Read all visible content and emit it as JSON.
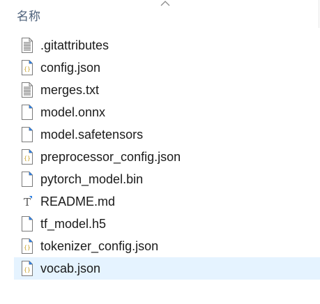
{
  "header": {
    "column_name": "名称",
    "sort_icon": "chevron-up-icon"
  },
  "files": [
    {
      "name": ".gitattributes",
      "icon": "text-file-icon"
    },
    {
      "name": "config.json",
      "icon": "json-file-icon"
    },
    {
      "name": "merges.txt",
      "icon": "text-file-icon"
    },
    {
      "name": "model.onnx",
      "icon": "blank-file-icon"
    },
    {
      "name": "model.safetensors",
      "icon": "blank-file-icon"
    },
    {
      "name": "preprocessor_config.json",
      "icon": "json-file-icon"
    },
    {
      "name": "pytorch_model.bin",
      "icon": "blank-file-icon"
    },
    {
      "name": "README.md",
      "icon": "typora-file-icon"
    },
    {
      "name": "tf_model.h5",
      "icon": "blank-file-icon"
    },
    {
      "name": "tokenizer_config.json",
      "icon": "json-file-icon"
    },
    {
      "name": "vocab.json",
      "icon": "json-file-icon",
      "selected": true
    }
  ],
  "colors": {
    "selection": "#e5f3ff",
    "header_text": "#4c607a",
    "icon_accent": "#2a7de1",
    "json_brace": "#c9a22b"
  }
}
